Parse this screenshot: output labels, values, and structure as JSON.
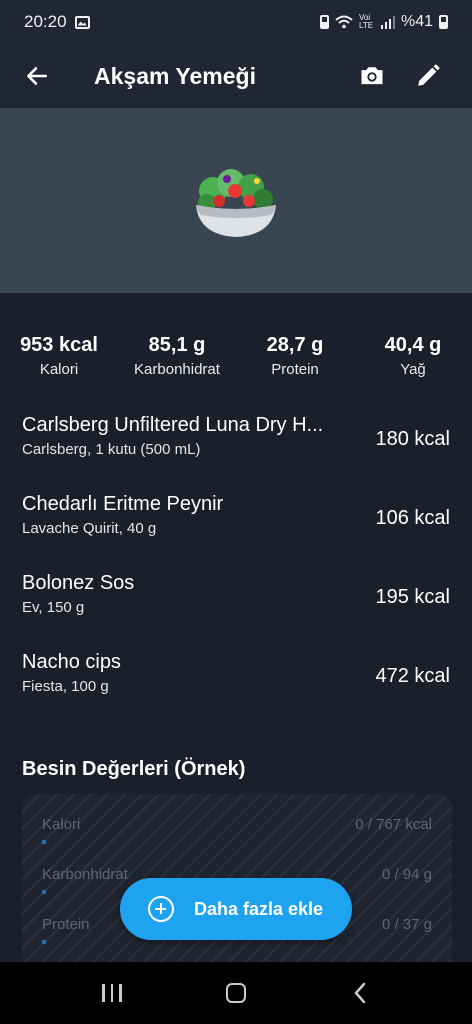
{
  "status_bar": {
    "time": "20:20",
    "network": "Voi LTE",
    "battery": "%41"
  },
  "app_bar": {
    "title": "Akşam Yemeği",
    "back_icon": "arrow-left-icon",
    "camera_icon": "camera-icon",
    "edit_icon": "pencil-icon"
  },
  "hero": {
    "emoji": "🥗"
  },
  "summary": [
    {
      "value": "953 kcal",
      "label": "Kalori"
    },
    {
      "value": "85,1 g",
      "label": "Karbonhidrat"
    },
    {
      "value": "28,7 g",
      "label": "Protein"
    },
    {
      "value": "40,4 g",
      "label": "Yağ"
    }
  ],
  "foods": [
    {
      "name": "Carlsberg Unfiltered Luna Dry H...",
      "detail": "Carlsberg, 1 kutu (500 mL)",
      "kcal": "180 kcal"
    },
    {
      "name": "Chedarlı Eritme Peynir",
      "detail": "Lavache Quirit, 40 g",
      "kcal": "106 kcal"
    },
    {
      "name": "Bolonez Sos",
      "detail": "Ev, 150 g",
      "kcal": "195 kcal"
    },
    {
      "name": "Nacho cips",
      "detail": "Fiesta, 100 g",
      "kcal": "472 kcal"
    }
  ],
  "nutrition": {
    "title": "Besin Değerleri (Örnek)",
    "rows": [
      {
        "label": "Kalori",
        "value": "0 / 767 kcal",
        "progress": 0
      },
      {
        "label": "Karbonhidrat",
        "value": "0 / 94 g",
        "progress": 0
      },
      {
        "label": "Protein",
        "value": "0 / 37 g",
        "progress": 0
      }
    ]
  },
  "fab": {
    "label": "Daha fazla ekle",
    "icon": "plus-circle-icon"
  },
  "colors": {
    "background": "#1a1f2b",
    "app_bar": "#202634",
    "hero": "#3a4552",
    "accent": "#1ea3f0"
  }
}
